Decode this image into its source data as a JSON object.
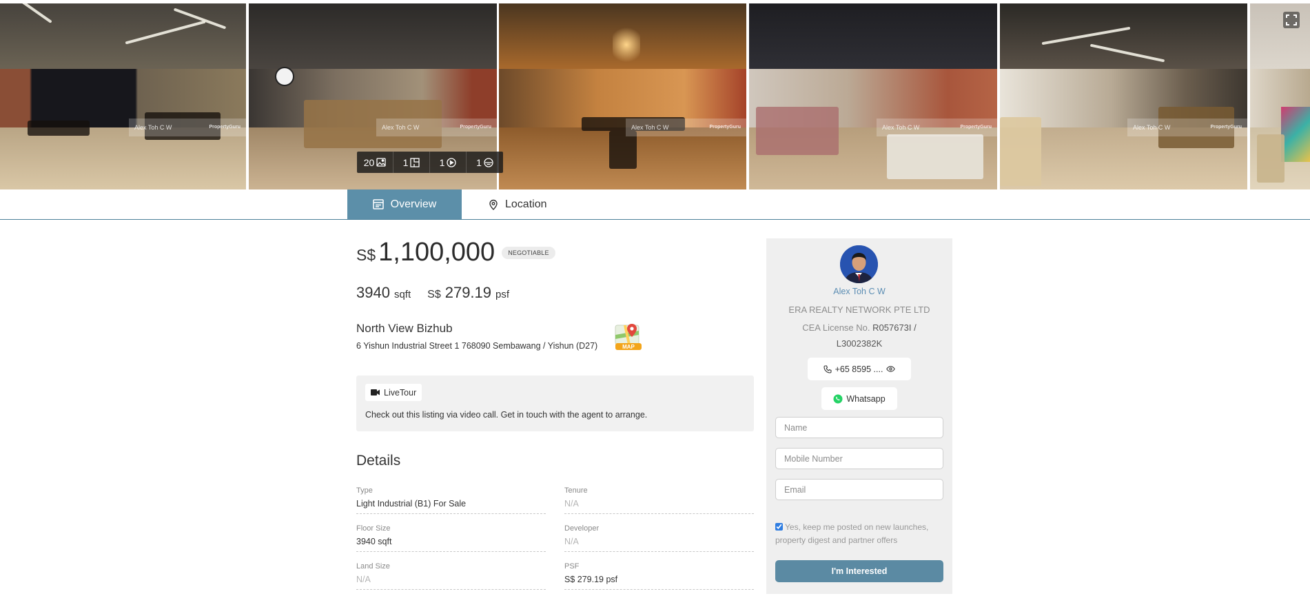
{
  "gallery": {
    "watermark": "Alex Toh C W",
    "watermark_brand": "PropertyGuru",
    "counters": [
      {
        "count": "20",
        "icon": "image-icon"
      },
      {
        "count": "1",
        "icon": "floorplan-icon"
      },
      {
        "count": "1",
        "icon": "video-icon"
      },
      {
        "count": "1",
        "icon": "virtual-tour-icon"
      }
    ]
  },
  "tabs": {
    "overview": "Overview",
    "location": "Location",
    "active": "overview"
  },
  "listing": {
    "currency": "S$",
    "price": "1,100,000",
    "negotiable": "NEGOTIABLE",
    "floor_size": "3940",
    "floor_unit": "sqft",
    "psf_currency": "S$",
    "psf": "279.19",
    "psf_unit": "psf",
    "project_name": "North View Bizhub",
    "address": "6 Yishun Industrial Street 1 768090 Sembawang / Yishun (D27)",
    "map_label": "MAP"
  },
  "livetour": {
    "badge": "LiveTour",
    "text": "Check out this listing via video call. Get in touch with the agent to arrange."
  },
  "details": {
    "title": "Details",
    "items": [
      {
        "label": "Type",
        "value": "Light Industrial (B1) For Sale"
      },
      {
        "label": "Tenure",
        "value": "N/A"
      },
      {
        "label": "Floor Size",
        "value": "3940 sqft"
      },
      {
        "label": "Developer",
        "value": "N/A"
      },
      {
        "label": "Land Size",
        "value": "N/A"
      },
      {
        "label": "PSF",
        "value": "S$ 279.19 psf"
      }
    ]
  },
  "agent": {
    "name": "Alex Toh C W",
    "agency": "ERA REALTY NETWORK PTE LTD",
    "license_prefix": "CEA License No.",
    "license_no": "R057673I / L3002382K",
    "phone": "+65 8595 ....",
    "whatsapp": "Whatsapp"
  },
  "form": {
    "name_placeholder": "Name",
    "mobile_placeholder": "Mobile Number",
    "email_placeholder": "Email",
    "consent": "Yes, keep me posted on new launches, property digest and partner offers",
    "consent_checked": true,
    "submit": "I'm Interested"
  },
  "colors": {
    "accent": "#5c8fa9",
    "agent_name": "#5b8db3",
    "panel_bg": "#efefef"
  }
}
